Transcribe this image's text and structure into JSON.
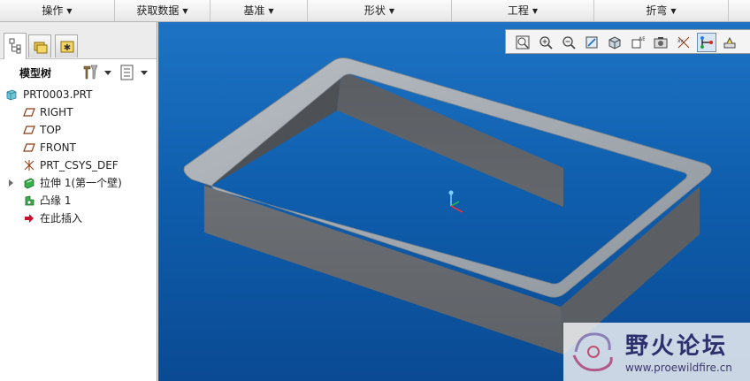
{
  "menubar": {
    "items": [
      {
        "label": "操作"
      },
      {
        "label": "获取数据"
      },
      {
        "label": "基准"
      },
      {
        "label": "形状"
      },
      {
        "label": "工程"
      },
      {
        "label": "折弯"
      }
    ]
  },
  "left_panel": {
    "tabs": [
      {
        "icon": "model-tree-icon",
        "active": true
      },
      {
        "icon": "folder-browser-icon",
        "active": false
      },
      {
        "icon": "favorites-icon",
        "active": false
      }
    ],
    "tree_title": "模型树",
    "tree_items": [
      {
        "label": "PRT0003.PRT",
        "icon": "part-icon"
      },
      {
        "label": "RIGHT",
        "icon": "datum-plane-icon"
      },
      {
        "label": "TOP",
        "icon": "datum-plane-icon"
      },
      {
        "label": "FRONT",
        "icon": "datum-plane-icon"
      },
      {
        "label": "PRT_CSYS_DEF",
        "icon": "csys-icon"
      },
      {
        "label": "拉伸 1(第一个壁)",
        "icon": "extrude-wall-icon",
        "expandable": true
      },
      {
        "label": "凸缘 1",
        "icon": "flange-icon"
      },
      {
        "label": "在此插入",
        "icon": "insert-here-arrow-icon"
      }
    ]
  },
  "viewport": {
    "toolbar": [
      "refit-icon",
      "zoom-in-icon",
      "zoom-out-icon",
      "repaint-icon",
      "shading-icon",
      "saved-views-icon",
      "view-manager-icon",
      "datum-display-icon",
      "spin-center-icon",
      "annotation-icon"
    ],
    "active_tool": "spin-center-icon",
    "background_color": "#1565b5",
    "model_color": "#6e7277"
  },
  "watermark": {
    "title": "野火论坛",
    "url": "www.proewildfire.cn"
  }
}
